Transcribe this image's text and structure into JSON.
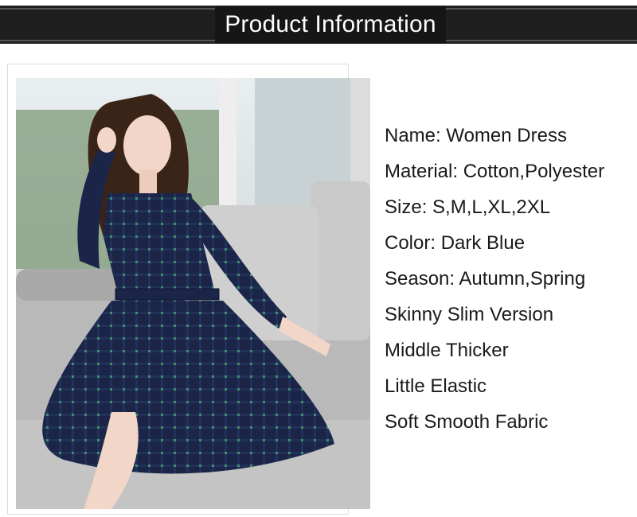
{
  "header": {
    "title": "Product Information"
  },
  "product_photo": {
    "icon": "model-in-plaid-dress-photo"
  },
  "info": {
    "lines": [
      "Name: Women Dress",
      "Material: Cotton,Polyester",
      "Size: S,M,L,XL,2XL",
      "Color: Dark Blue",
      "Season: Autumn,Spring",
      "Skinny Slim Version",
      "Middle Thicker",
      "Little Elastic",
      "Soft Smooth Fabric"
    ]
  },
  "colors": {
    "header_bg": "#1f1f1f",
    "dress": "#1a2547",
    "dress_pattern": "#3f8f6a",
    "sofa": "#b9b9b9"
  }
}
